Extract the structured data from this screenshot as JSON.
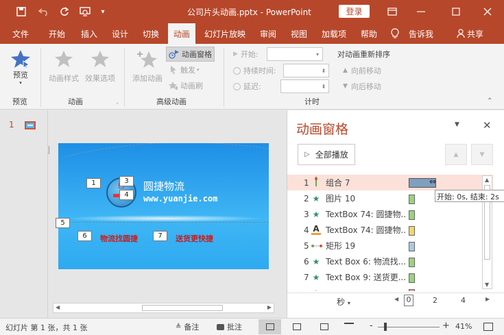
{
  "window": {
    "title": "公司片头动画.pptx  -  PowerPoint",
    "login_label": "登录"
  },
  "tabs": [
    {
      "label": "文件",
      "active": false
    },
    {
      "label": "开始",
      "active": false
    },
    {
      "label": "插入",
      "active": false
    },
    {
      "label": "设计",
      "active": false
    },
    {
      "label": "切换",
      "active": false
    },
    {
      "label": "动画",
      "active": true
    },
    {
      "label": "幻灯片放映",
      "active": false
    },
    {
      "label": "审阅",
      "active": false
    },
    {
      "label": "视图",
      "active": false
    },
    {
      "label": "加载项",
      "active": false
    },
    {
      "label": "帮助",
      "active": false
    },
    {
      "label": "告诉我",
      "active": false
    },
    {
      "label": "共享",
      "active": false
    }
  ],
  "ribbon": {
    "preview_label": "预览",
    "group_preview": "预览",
    "anim_style_label": "动画样式",
    "effect_options_label": "效果选项",
    "group_animation": "动画",
    "add_anim_label": "添加动画",
    "anim_pane_label": "动画窗格",
    "trigger_label": "触发",
    "anim_painter_label": "动画刷",
    "group_advanced": "高级动画",
    "start_label": "开始:",
    "duration_label": "持续时间:",
    "delay_label": "延迟:",
    "group_timing": "计时",
    "reorder_label": "对动画重新排序",
    "move_earlier_label": "向前移动",
    "move_later_label": "向后移动"
  },
  "thumbnail": {
    "number": "1"
  },
  "slide": {
    "company_name": "圆捷物流",
    "website": "www.yuanjie.com",
    "slogan_left": "物流找圆捷",
    "slogan_right": "送货更快捷",
    "tags": [
      "1",
      "3",
      "4",
      "5",
      "6",
      "7"
    ]
  },
  "anim_pane": {
    "title": "动画窗格",
    "play_all_label": "全部播放",
    "items": [
      {
        "num": "1",
        "name": "组合 7",
        "icon": "group-anim-icon",
        "color": "#7e9fbf",
        "selected": true
      },
      {
        "num": "2",
        "name": "图片 10",
        "icon": "star-icon",
        "color": "#9bd27e",
        "selected": false
      },
      {
        "num": "3",
        "name": "TextBox 74: 圆捷物...",
        "icon": "star-icon",
        "color": "#9bd27e",
        "selected": false
      },
      {
        "num": "4",
        "name": "TextBox 74: 圆捷物...",
        "icon": "font-color-icon",
        "color": "#f6d46b",
        "selected": false
      },
      {
        "num": "5",
        "name": "矩形 19",
        "icon": "motion-path-icon",
        "color": "#a9cbe0",
        "selected": false
      },
      {
        "num": "6",
        "name": "Text Box 6: 物流找...",
        "icon": "star-icon",
        "color": "#9bd27e",
        "selected": false
      },
      {
        "num": "7",
        "name": "Text Box 9: 送货更...",
        "icon": "star-icon",
        "color": "#9bd27e",
        "selected": false
      }
    ],
    "tooltip": "开始: 0s, 结束: 2s",
    "seconds_label": "秒",
    "timeline_ticks": [
      "0",
      "2",
      "4"
    ]
  },
  "status": {
    "slide_info": "幻灯片 第 1 张，共 1 张",
    "notes_label": "备注",
    "comments_label": "批注",
    "zoom_minus": "-",
    "zoom_plus": "+",
    "zoom_level": "41%"
  }
}
